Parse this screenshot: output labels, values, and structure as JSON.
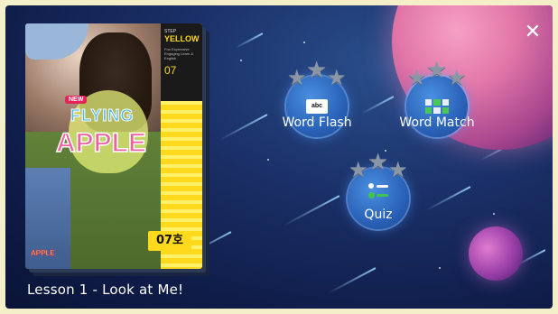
{
  "window": {
    "close_icon": "close-icon"
  },
  "book": {
    "step_label": "STEP",
    "level_label": "YELLOW",
    "tagline": "Fun Expressive Engaging Learn & English",
    "issue_number": "07",
    "new_badge": "NEW",
    "title_line1": "FLYING",
    "title_line2": "APPLE",
    "issue_tag": "07호",
    "corner_logo": "APPLE"
  },
  "lesson": {
    "title": "Lesson 1 - Look at Me!"
  },
  "activities": [
    {
      "label": "Word Flash",
      "icon": "word-flash-icon",
      "icon_text": "abc",
      "stars_earned": 0,
      "stars_total": 3
    },
    {
      "label": "Word Match",
      "icon": "word-match-icon",
      "stars_earned": 0,
      "stars_total": 3
    },
    {
      "label": "Quiz",
      "icon": "quiz-icon",
      "stars_earned": 0,
      "stars_total": 3
    }
  ],
  "colors": {
    "background": "#0f1c48",
    "accent_blue": "#2a62b8",
    "star_empty": "#8a96a6",
    "cover_yellow": "#ffd91c",
    "frame": "#f5efc9"
  }
}
